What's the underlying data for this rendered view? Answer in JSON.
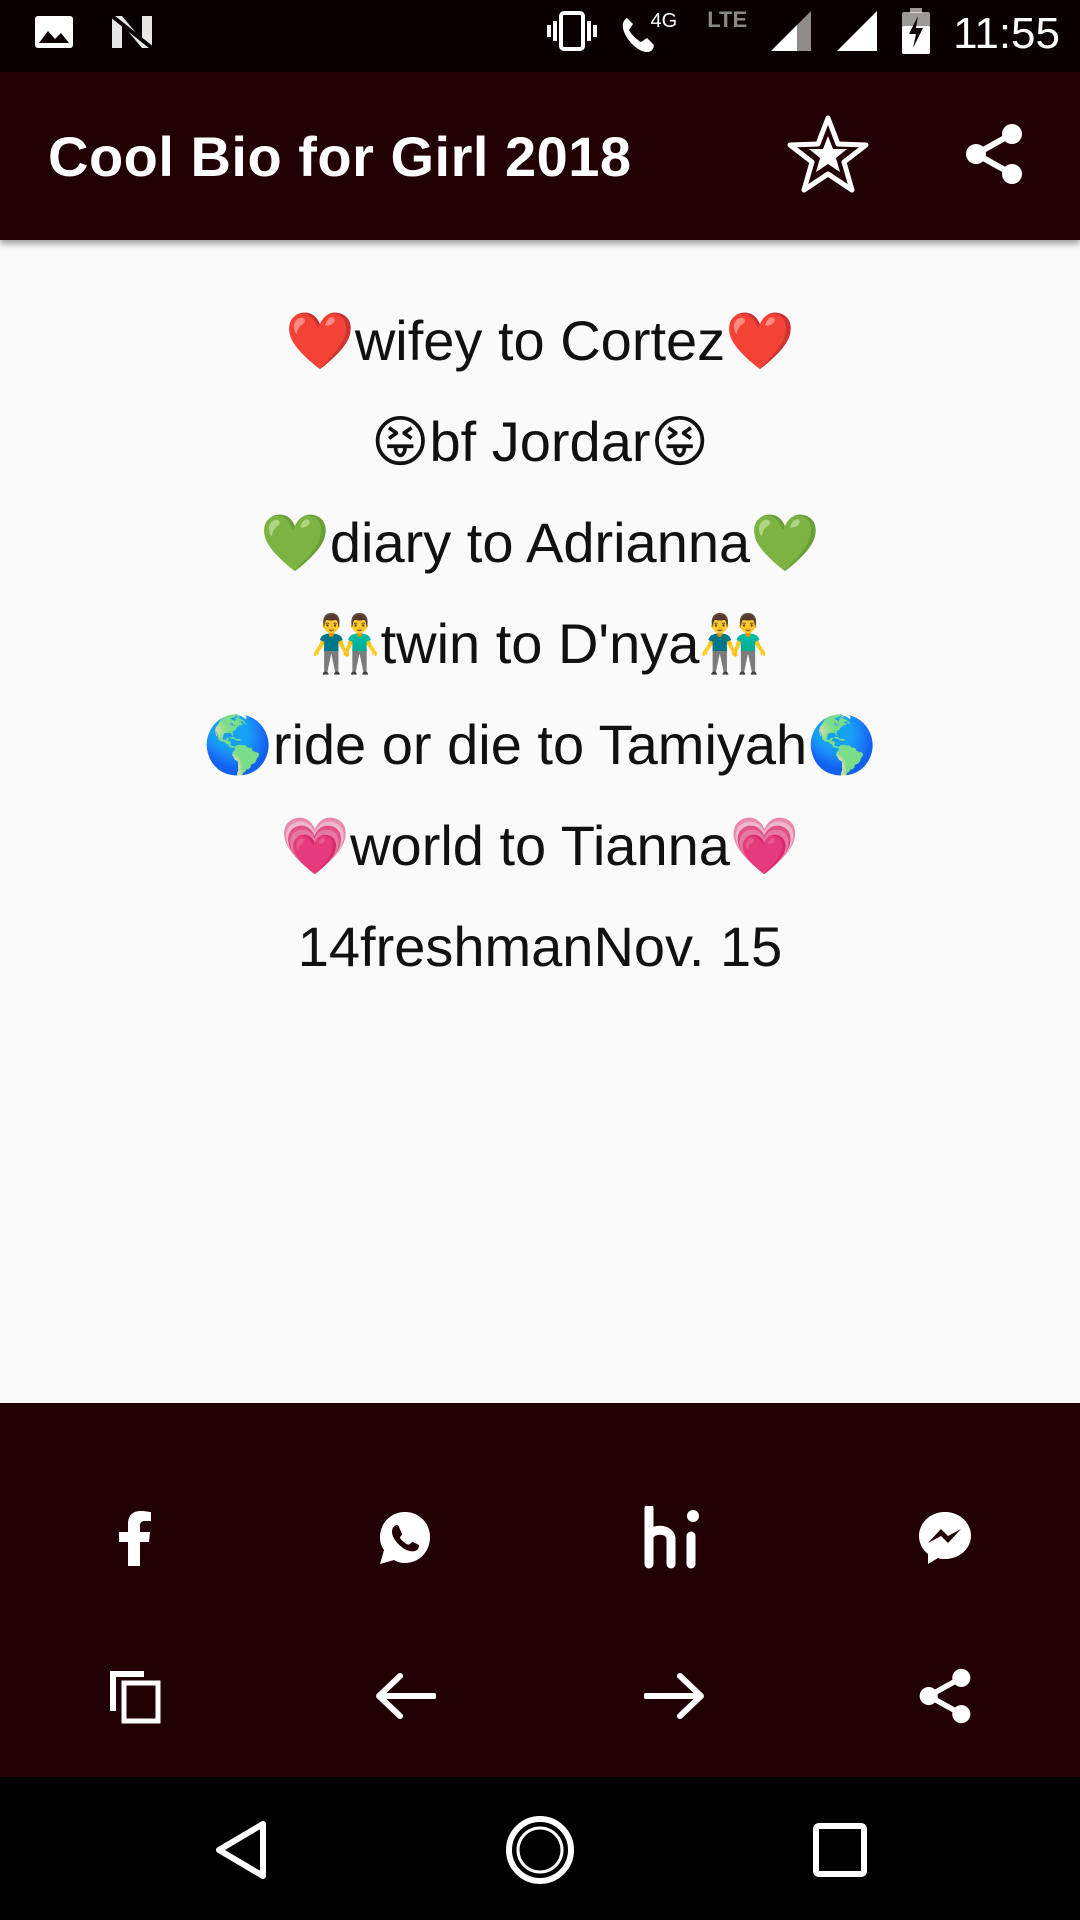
{
  "status_bar": {
    "time": "11:55",
    "network_label": "4G",
    "lte_label": "LTE",
    "icons": [
      "image-icon",
      "n-logo-icon",
      "vibrate-icon",
      "wifi-call-icon",
      "signal-icon",
      "signal-icon",
      "battery-charging-icon"
    ]
  },
  "app_bar": {
    "title": "Cool Bio for Girl 2018",
    "favorite_icon": "star-icon",
    "share_icon": "share-icon"
  },
  "bio": {
    "lines": [
      "❤️wifey to Cortez❤️",
      "😝bf Jordar😝",
      "💚diary to Adrianna💚",
      "👬twin to D'nya👬",
      "🌎ride or die to Tamiyah🌎",
      "💗world to Tianna💗",
      "14freshmanNov. 15"
    ]
  },
  "share_actions": {
    "row1": [
      "facebook-icon",
      "whatsapp-icon",
      "hike-icon",
      "messenger-icon"
    ],
    "row2": [
      "copy-icon",
      "arrow-left-icon",
      "arrow-right-icon",
      "share-icon"
    ]
  },
  "nav_bar": {
    "icons": [
      "back-icon",
      "home-icon",
      "recents-icon"
    ]
  },
  "colors": {
    "app_bar": "#220105",
    "status_bar": "#0a0000",
    "background": "#fafafa",
    "text": "#111111"
  }
}
